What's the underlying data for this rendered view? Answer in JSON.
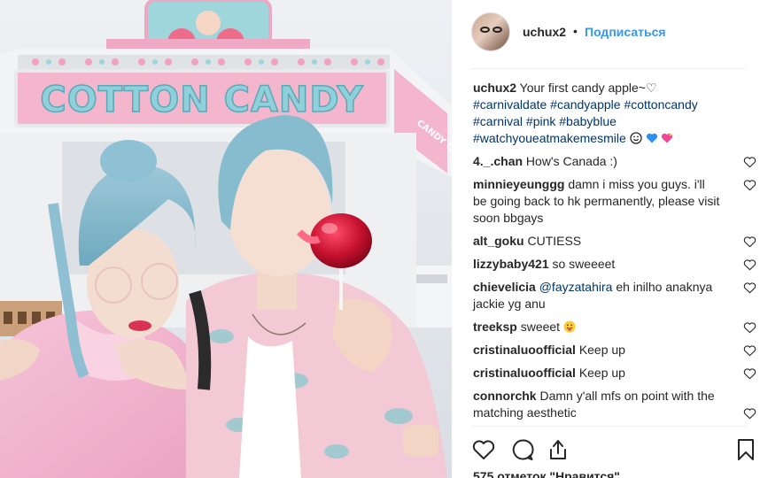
{
  "post": {
    "username": "uchux2",
    "separator": "•",
    "follow_label": "Подписаться",
    "caption_lines": [
      "Your first candy apple~♡",
      "#carnivaldate #candyapple #cottoncandy",
      "#carnival #pink #babyblue",
      "#watchyoueatmakemesmile"
    ],
    "booth_sign": "COTTON CANDY",
    "booth_side_sign": "CANDY COTTON",
    "likes_text": "575 отметок \"Нравится\""
  },
  "comments": [
    {
      "user": "4._.chan",
      "text": "How's Canada :)"
    },
    {
      "user": "minnieyeunggg",
      "text": "damn i miss you guys. i'll be going back to hk permanently, please visit soon bbgays"
    },
    {
      "user": "alt_goku",
      "text": "CUTIESS"
    },
    {
      "user": "lizzybaby421",
      "text": "so sweeeet"
    },
    {
      "user": "chievelicia",
      "mention": "@fayzatahira",
      "text": "eh inilho anaknya jackie yg anu"
    },
    {
      "user": "treeksp",
      "text": "sweeet"
    },
    {
      "user": "cristinaluoofficial",
      "text": "Keep up"
    },
    {
      "user": "cristinaluoofficial",
      "text": "Keep up"
    },
    {
      "user": "connorchk",
      "text": "Damn y'all mfs on point with the matching aesthetic"
    }
  ],
  "icons": {
    "like": "heart-icon",
    "comment": "comment-icon",
    "share": "share-icon",
    "save": "bookmark-icon",
    "comment_like": "small-heart-icon"
  },
  "colors": {
    "link_blue": "#3897f0",
    "hashtag": "#003569",
    "text": "#262626",
    "border": "#efefef"
  }
}
